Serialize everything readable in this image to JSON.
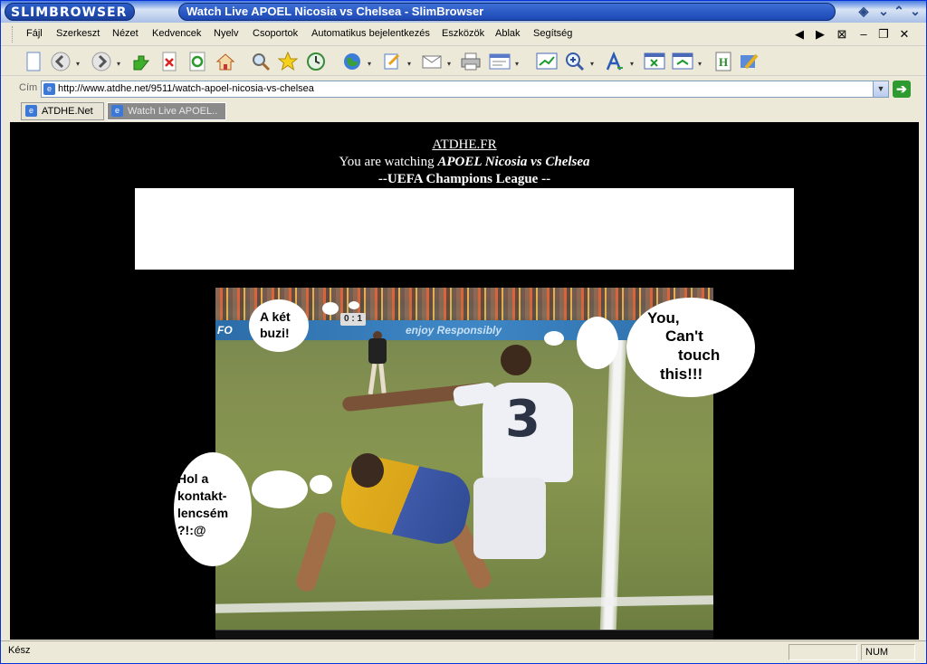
{
  "window": {
    "logo": "SLIMBROWSER",
    "title": "Watch Live APOEL Nicosia vs Chelsea - SlimBrowser"
  },
  "menubar": {
    "items": [
      "Fájl",
      "Szerkeszt",
      "Nézet",
      "Kedvencek",
      "Nyelv",
      "Csoportok",
      "Automatikus bejelentkezés",
      "Eszközök",
      "Ablak",
      "Segítség"
    ]
  },
  "address": {
    "label": "Cím",
    "url": "http://www.atdhe.net/9511/watch-apoel-nicosia-vs-chelsea"
  },
  "tabs": [
    {
      "label": "ATDHE.Net",
      "active": false
    },
    {
      "label": "Watch Live APOEL..",
      "active": true
    }
  ],
  "page": {
    "site_link": "ATDHE.FR",
    "watching_prefix": "You are watching ",
    "match": "APOEL Nicosia vs Chelsea",
    "competition": "--UEFA Champions League --"
  },
  "video": {
    "score": "0 : 1",
    "ad_board_text": "enjoy Responsibly",
    "ad_board_left": "FO",
    "shirt_number": "3"
  },
  "bubbles": {
    "top_left": [
      "A két",
      "buzi!"
    ],
    "right": [
      "You,",
      "Can't",
      "touch",
      "this!!!"
    ],
    "bottom_left": [
      "Hol a",
      "kontakt-",
      "lencsém",
      "?!:@"
    ]
  },
  "status": {
    "text": "Kész",
    "num": "NUM"
  },
  "colors": {
    "title_blue": "#1d48b3",
    "page_bg": "#000000",
    "go_green": "#2f9a2f"
  }
}
